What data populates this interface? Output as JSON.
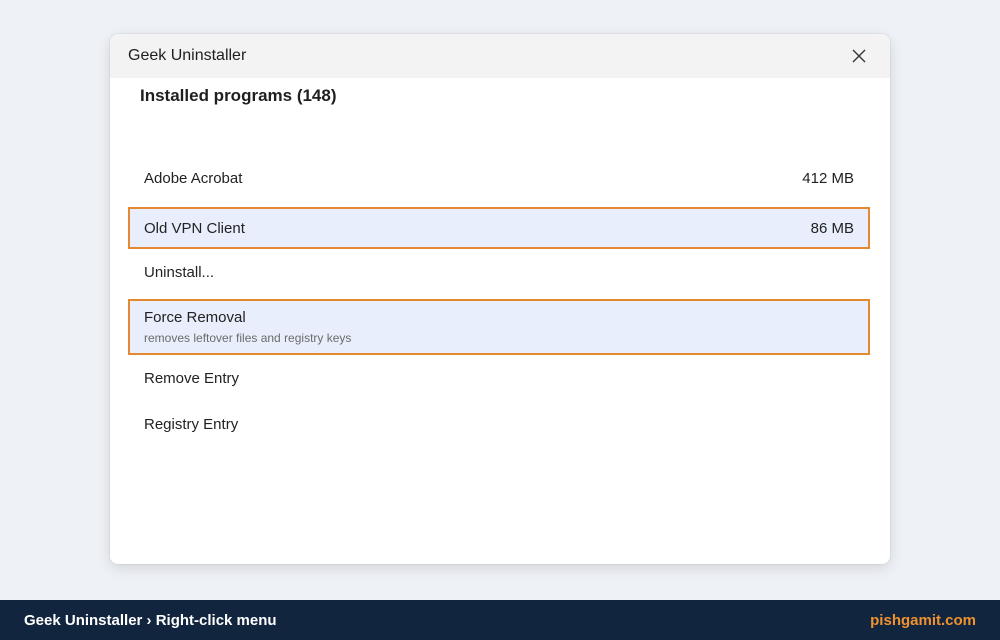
{
  "window": {
    "title": "Geek Uninstaller"
  },
  "list": {
    "heading": "Installed programs (148)",
    "programs": [
      {
        "name": "Adobe Acrobat",
        "size": "412 MB"
      },
      {
        "name": "Old VPN Client",
        "size": "86 MB"
      }
    ]
  },
  "context_menu": {
    "items": [
      {
        "label": "Uninstall..."
      },
      {
        "label": "Force Removal",
        "description": "removes leftover files and registry keys"
      },
      {
        "label": "Remove Entry"
      },
      {
        "label": "Registry Entry"
      }
    ]
  },
  "footer": {
    "breadcrumb": "Geek Uninstaller › Right-click menu",
    "brand": "pishgamit.com"
  },
  "colors": {
    "highlight_border": "#e4892f",
    "highlight_fill": "#e8eefb",
    "footer_bg": "#12253e",
    "brand_accent": "#f0922f"
  },
  "icons": {
    "close": "close-icon"
  }
}
